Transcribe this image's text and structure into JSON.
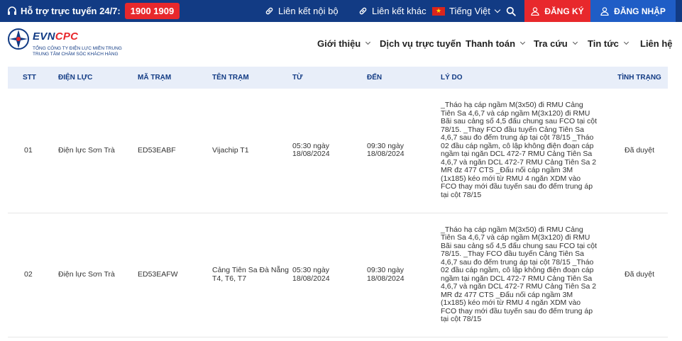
{
  "topbar": {
    "hotline_label": "Hỗ trợ trực tuyến 24/7:",
    "hotline_number": "1900 1909",
    "internal_link": "Liên kết nội bộ",
    "other_link": "Liên kết khác",
    "language": "Tiếng Việt",
    "register": "ĐĂNG KÝ",
    "login": "ĐĂNG NHẬP"
  },
  "logo": {
    "evn": "EVN",
    "cpc": "CPC",
    "line1": "TỔNG CÔNG TY ĐIỆN LỰC MIỀN TRUNG",
    "line2": "TRUNG TÂM CHĂM SÓC KHÁCH HÀNG"
  },
  "nav": {
    "items": [
      "Giới thiệu",
      "Dịch vụ trực tuyến",
      "Thanh toán",
      "Tra cứu",
      "Tin tức",
      "Liên hệ"
    ]
  },
  "table": {
    "headers": [
      "STT",
      "ĐIỆN LỰC",
      "MÃ TRẠM",
      "TÊN TRẠM",
      "TỪ",
      "ĐẾN",
      "LÝ DO",
      "TÌNH TRẠNG"
    ],
    "rows": [
      {
        "stt": "01",
        "dien_luc": "Điện lực Sơn Trà",
        "ma_tram": "ED53EABF",
        "ten_tram": "Vijachip T1",
        "tu": "05:30 ngày 18/08/2024",
        "den": "09:30 ngày 18/08/2024",
        "ly_do": "_Tháo hạ cáp ngầm M(3x50) đi RMU Cảng Tiên Sa 4,6,7 và cáp ngầm M(3x120) đi RMU Bãi sau cảng số 4,5 đấu chung sau FCO tại cột 78/15. _Thay FCO đầu tuyến Cảng Tiên Sa 4,6,7 sau đo đếm trung áp tại cột 78/15 _Tháo 02 đầu cáp ngầm, cô lập không điện đoạn cáp ngầm tại ngăn DCL 472-7 RMU Cảng Tiên Sa 4,6,7 và ngăn DCL 472-7 RMU Cảng Tiên Sa 2 MR đz 477 CTS _Đấu nối cáp ngầm 3M (1x185) kéo mới từ RMU 4 ngăn XDM vào FCO thay mới đầu tuyến sau đo đếm trung áp tại cột 78/15",
        "tinh_trang": "Đã duyệt"
      },
      {
        "stt": "02",
        "dien_luc": "Điện lực Sơn Trà",
        "ma_tram": "ED53EAFW",
        "ten_tram": "Cảng Tiên Sa Đà Nẵng T4, T6, T7",
        "tu": "05:30 ngày 18/08/2024",
        "den": "09:30 ngày 18/08/2024",
        "ly_do": "_Tháo hạ cáp ngầm M(3x50) đi RMU Cảng Tiên Sa 4,6,7 và cáp ngầm M(3x120) đi RMU Bãi sau cảng số 4,5 đấu chung sau FCO tại cột 78/15. _Thay FCO đầu tuyến Cảng Tiên Sa 4,6,7 sau đo đếm trung áp tại cột 78/15 _Tháo 02 đầu cáp ngầm, cô lập không điện đoạn cáp ngầm tại ngăn DCL 472-7 RMU Cảng Tiên Sa 4,6,7 và ngăn DCL 472-7 RMU Cảng Tiên Sa 2 MR đz 477 CTS _Đấu nối cáp ngầm 3M (1x185) kéo mới từ RMU 4 ngăn XDM vào FCO thay mới đầu tuyến sau đo đếm trung áp tại cột 78/15",
        "tinh_trang": "Đã duyệt"
      }
    ]
  },
  "colors": {
    "topbar_bg": "#123b84",
    "hotline_bg": "#e8282c",
    "register_bg": "#e8282c",
    "login_bg": "#1f5dc6",
    "table_header_bg": "#e8eef9",
    "table_header_text": "#123b84"
  },
  "icons": [
    "headset-icon",
    "link-icon",
    "vietnam-flag-icon",
    "search-icon",
    "user-icon",
    "chevron-down-icon",
    "evn-logo-icon"
  ]
}
